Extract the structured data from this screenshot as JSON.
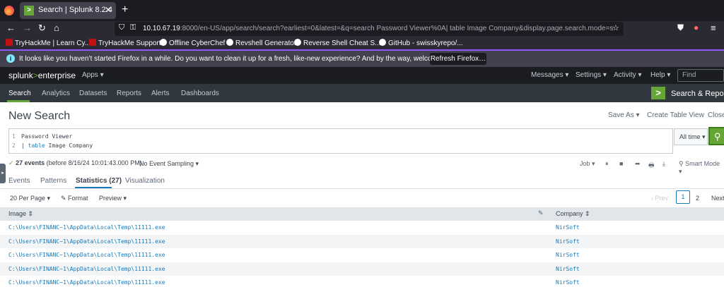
{
  "browser": {
    "tab_title": "Search | Splunk 8.2.4",
    "tab_close": "✕",
    "new_tab": "+",
    "url_host": "10.10.67.19",
    "url_rest": ":8000/en-US/app/search/search?earliest=0&latest=&q=search Password Viewer%0A| table Image Company&display.page.search.mode=smart&d",
    "bookmarks": [
      {
        "label": "TryHackMe | Learn Cy...",
        "color": "#c11111"
      },
      {
        "label": "TryHackMe Support",
        "color": "#c11111"
      },
      {
        "label": "Offline CyberChef",
        "color": "#ffffff"
      },
      {
        "label": "Revshell Generator",
        "color": "#ffffff"
      },
      {
        "label": "Reverse Shell Cheat S...",
        "color": "#ffffff"
      },
      {
        "label": "GitHub - swisskyrepo/...",
        "color": "#ffffff"
      }
    ],
    "notice_text": "It looks like you haven’t started Firefox in a while. Do you want to clean it up for a fresh, like-new experience? And by the way, welcome back!",
    "notice_button": "Refresh Firefox…"
  },
  "splunk": {
    "logo_main": "splunk",
    "logo_gt": ">",
    "logo_suffix": "enterprise",
    "apps_menu": "Apps ▾",
    "top_menu": [
      "Messages ▾",
      "Settings ▾",
      "Activity ▾",
      "Help ▾"
    ],
    "find_placeholder": "Find",
    "app_tabs": [
      "Search",
      "Analytics",
      "Datasets",
      "Reports",
      "Alerts",
      "Dashboards"
    ],
    "app_name": "Search & Reporting",
    "accent": "#65a637"
  },
  "page": {
    "title": "New Search",
    "actions": [
      "Save As ▾",
      "Create Table View",
      "Close"
    ],
    "query_lines": [
      {
        "num": "1",
        "text": "Password Viewer"
      },
      {
        "num": "2",
        "pipe": "| ",
        "cmd": "table",
        "args": " Image Company"
      }
    ],
    "time_picker": "All time ▾",
    "status_check": "✓",
    "status_count": "27 events",
    "status_detail": " (before 8/16/24 10:01:43.000 PM)",
    "sampling": "No Event Sampling ▾",
    "job_controls": [
      "Job ▾",
      "⏸",
      "■",
      "➦",
      "🖶",
      "⤓",
      "⚲ Smart Mode ▾"
    ],
    "result_tabs": [
      "Events",
      "Patterns",
      "Statistics (27)",
      "Visualization"
    ],
    "table_controls": [
      "20 Per Page ▾",
      "✎ Format",
      "Preview ▾"
    ],
    "pager": {
      "prev": "‹ Prev",
      "page1": "1",
      "page2": "2",
      "next": "Next"
    }
  },
  "table": {
    "columns": [
      "Image ⇕",
      "Company ⇕"
    ],
    "rows": [
      {
        "image": "C:\\Users\\FINANC~1\\AppData\\Local\\Temp\\11111.exe",
        "company": "NirSoft"
      },
      {
        "image": "C:\\Users\\FINANC~1\\AppData\\Local\\Temp\\11111.exe",
        "company": "NirSoft"
      },
      {
        "image": "C:\\Users\\FINANC~1\\AppData\\Local\\Temp\\11111.exe",
        "company": "NirSoft"
      },
      {
        "image": "C:\\Users\\FINANC~1\\AppData\\Local\\Temp\\11111.exe",
        "company": "NirSoft"
      },
      {
        "image": "C:\\Users\\FINANC~1\\AppData\\Local\\Temp\\11111.exe",
        "company": "NirSoft"
      }
    ]
  }
}
